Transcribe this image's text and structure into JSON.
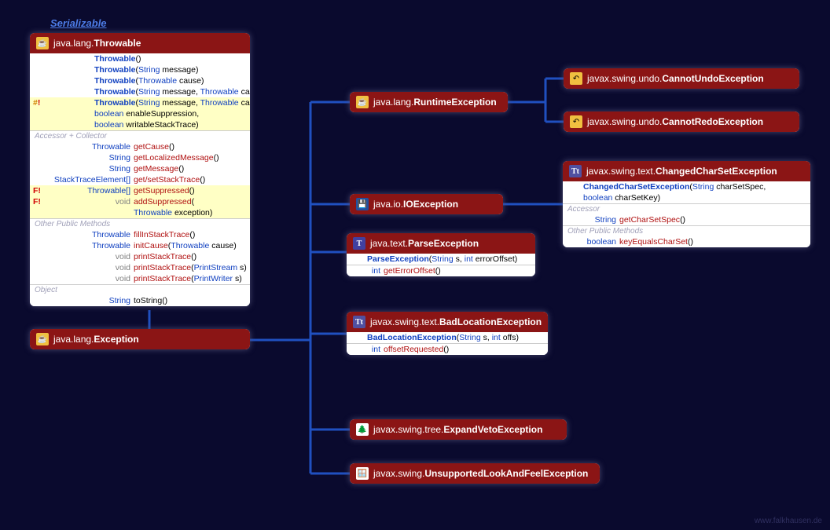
{
  "serializable_label": "Serializable",
  "footer": "www.falkhausen.de",
  "throwable": {
    "pkg": "java.lang.",
    "cls": "Throwable",
    "ctors": [
      {
        "name": "Throwable",
        "params": "()",
        "hl": false,
        "mod": ""
      },
      {
        "name": "Throwable",
        "params": "(String message)",
        "hl": false,
        "mod": ""
      },
      {
        "name": "Throwable",
        "params": "(Throwable cause)",
        "hl": false,
        "mod": ""
      },
      {
        "name": "Throwable",
        "params": "(String message, Throwable cause)",
        "hl": false,
        "mod": ""
      },
      {
        "name": "Throwable",
        "params": "(String message, Throwable cause,",
        "hl": true,
        "mod": "#!"
      },
      {
        "name": "",
        "params": "boolean enableSuppression,",
        "hl": true,
        "mod": "",
        "cont": true
      },
      {
        "name": "",
        "params": "boolean writableStackTrace)",
        "hl": true,
        "mod": "",
        "cont": true
      }
    ],
    "acc_label": "Accessor + Collector",
    "acc": [
      {
        "ret": "Throwable",
        "name": "getCause",
        "params": "()",
        "mod": ""
      },
      {
        "ret": "String",
        "name": "getLocalizedMessage",
        "params": "()",
        "mod": ""
      },
      {
        "ret": "String",
        "name": "getMessage",
        "params": "()",
        "mod": ""
      },
      {
        "ret": "StackTraceElement[]",
        "name": "get/setStackTrace",
        "params": "()",
        "mod": ""
      },
      {
        "ret": "Throwable[]",
        "name": "getSuppressed",
        "params": "()",
        "mod": "F!",
        "hl": true
      },
      {
        "ret": "void",
        "name": "addSuppressed",
        "params": "(",
        "mod": "F!",
        "hl": true
      },
      {
        "ret": "",
        "name": "",
        "params": "Throwable exception)",
        "mod": "",
        "hl": true,
        "cont": true
      }
    ],
    "other_label": "Other Public Methods",
    "other": [
      {
        "ret": "Throwable",
        "name": "fillInStackTrace",
        "params": "()"
      },
      {
        "ret": "Throwable",
        "name": "initCause",
        "params": "(Throwable cause)"
      },
      {
        "ret": "void",
        "name": "printStackTrace",
        "params": "()"
      },
      {
        "ret": "void",
        "name": "printStackTrace",
        "params": "(PrintStream s)"
      },
      {
        "ret": "void",
        "name": "printStackTrace",
        "params": "(PrintWriter s)"
      }
    ],
    "obj_label": "Object",
    "obj": [
      {
        "ret": "String",
        "name": "toString",
        "params": "()"
      }
    ]
  },
  "exception": {
    "pkg": "java.lang.",
    "cls": "Exception"
  },
  "runtime": {
    "pkg": "java.lang.",
    "cls": "RuntimeException"
  },
  "ioexception": {
    "pkg": "java.io.",
    "cls": "IOException"
  },
  "parseex": {
    "pkg": "java.text.",
    "cls": "ParseException",
    "ctors": [
      {
        "name": "ParseException",
        "params": "(String s, int errorOffset)"
      }
    ],
    "methods": [
      {
        "ret": "int",
        "name": "getErrorOffset",
        "params": "()"
      }
    ]
  },
  "badloc": {
    "pkg": "javax.swing.text.",
    "cls": "BadLocationException",
    "ctors": [
      {
        "name": "BadLocationException",
        "params": "(String s, int offs)"
      }
    ],
    "methods": [
      {
        "ret": "int",
        "name": "offsetRequested",
        "params": "()"
      }
    ]
  },
  "expandveto": {
    "pkg": "javax.swing.tree.",
    "cls": "ExpandVetoException"
  },
  "unsupported": {
    "pkg": "javax.swing.",
    "cls": "UnsupportedLookAndFeelException"
  },
  "undo": {
    "pkg": "javax.swing.undo.",
    "cls": "CannotUndoException"
  },
  "redo": {
    "pkg": "javax.swing.undo.",
    "cls": "CannotRedoException"
  },
  "changed": {
    "pkg": "javax.swing.text.",
    "cls": "ChangedCharSetException",
    "ctors": [
      {
        "name": "ChangedCharSetException",
        "params": "(String charSetSpec,"
      },
      {
        "name": "",
        "params": "boolean charSetKey)",
        "cont": true
      }
    ],
    "acc_label": "Accessor",
    "acc": [
      {
        "ret": "String",
        "name": "getCharSetSpec",
        "params": "()"
      }
    ],
    "other_label": "Other Public Methods",
    "other": [
      {
        "ret": "boolean",
        "name": "keyEqualsCharSet",
        "params": "()"
      }
    ]
  }
}
